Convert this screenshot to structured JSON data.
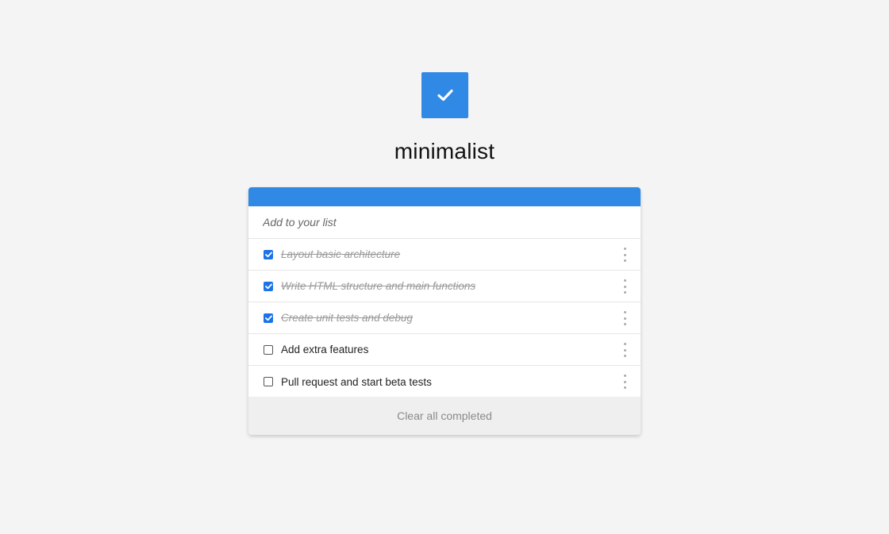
{
  "app": {
    "title": "minimalist",
    "logo_icon": "checkmark-icon",
    "accent_color": "#2f89e5"
  },
  "input": {
    "placeholder": "Add to your list",
    "value": ""
  },
  "todos": [
    {
      "label": "Layout basic architecture",
      "completed": true
    },
    {
      "label": "Write HTML structure and main functions",
      "completed": true
    },
    {
      "label": "Create unit tests and debug",
      "completed": true
    },
    {
      "label": "Add extra features",
      "completed": false
    },
    {
      "label": "Pull request and start beta tests",
      "completed": false
    }
  ],
  "footer": {
    "clear_label": "Clear all completed"
  }
}
